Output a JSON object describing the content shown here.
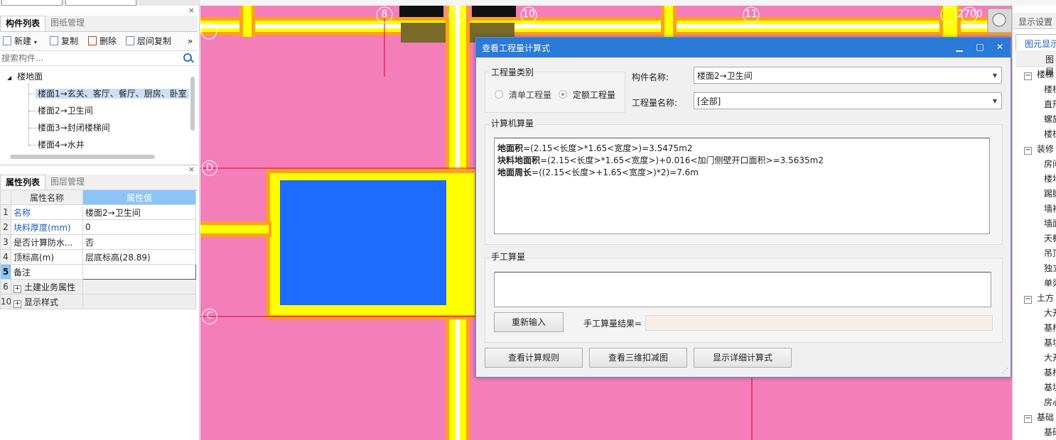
{
  "left_top": {
    "close": "×",
    "tabs": [
      "构件列表",
      "图纸管理"
    ],
    "toolbar": {
      "new": "新建",
      "copy": "复制",
      "delete": "删除",
      "floor_copy": "层间复制",
      "more": "»"
    },
    "search_placeholder": "搜索构件...",
    "tree": {
      "root": "楼地面",
      "items": [
        "楼面1→玄关、客厅、餐厅、厨房、卧室",
        "楼面2→卫生间",
        "楼面3→封闭楼梯间",
        "楼面4→水井"
      ]
    }
  },
  "left_bottom": {
    "close": "×",
    "tabs": [
      "属性列表",
      "图层管理"
    ],
    "header": {
      "name": "属性名称",
      "value": "属性值"
    },
    "rows": [
      {
        "num": "1",
        "name": "名称",
        "value": "楼面2→卫生间"
      },
      {
        "num": "2",
        "name": "块料厚度(mm)",
        "value": "0"
      },
      {
        "num": "3",
        "name": "是否计算防水...",
        "value": "否"
      },
      {
        "num": "4",
        "name": "顶标高(m)",
        "value": "层底标高(28.89)"
      },
      {
        "num": "5",
        "name": "备注",
        "value": ""
      },
      {
        "num": "6",
        "name": "土建业务属性",
        "value": ""
      },
      {
        "num": "10",
        "name": "显示样式",
        "value": ""
      }
    ]
  },
  "canvas": {
    "axis_labels": [
      "8",
      "9",
      "10",
      "11",
      "2700"
    ],
    "row_labels": [
      "D",
      "C"
    ]
  },
  "dialog": {
    "title": "查看工程量计算式",
    "window_buttons": {
      "min": "▁",
      "max": "□",
      "close": "✕"
    },
    "qty_type": {
      "label": "工程量类别",
      "options": [
        "清单工程量",
        "定额工程量"
      ],
      "selected": "定额工程量"
    },
    "component_name": {
      "label": "构件名称:",
      "value": "楼面2→卫生间"
    },
    "qty_name": {
      "label": "工程量名称:",
      "value": "[全部]"
    },
    "computer": {
      "label": "计算机算量",
      "lines": [
        {
          "key": "地面积",
          "expr": "=(2.15<长度>*1.65<宽度>)=3.5475m2"
        },
        {
          "key": "块料地面积",
          "expr": "=(2.15<长度>*1.65<宽度>)+0.016<加门侧壁开口面积>=3.5635m2"
        },
        {
          "key": "地面周长",
          "expr": "=((2.15<长度>+1.65<宽度>)*2)=7.6m"
        }
      ]
    },
    "manual": {
      "label": "手工算量",
      "reenter": "重新输入",
      "result_label": "手工算量结果="
    },
    "buttons": {
      "rules": "查看计算规则",
      "view3d": "查看三维扣减图",
      "detail": "显示详细计算式"
    }
  },
  "right_panel": {
    "title": "显示设置",
    "tab": "图元显示",
    "col_header": "图层",
    "groups": [
      {
        "label": "楼梯",
        "items": [
          "楼梯",
          "直形",
          "螺旋",
          "楼梯"
        ]
      },
      {
        "label": "装修",
        "items": [
          "房间",
          "楼地",
          "踢脚",
          "墙裙",
          "墙面",
          "天棚",
          "吊顶",
          "独立",
          "单梁"
        ]
      },
      {
        "label": "土方",
        "items": [
          "大开",
          "基槽",
          "基坑",
          "大开",
          "基槽",
          "基坑",
          "房心"
        ]
      },
      {
        "label": "基础",
        "items": [
          "基础"
        ]
      }
    ]
  },
  "colors": {
    "canvas_pink": "#f47eb9",
    "slab_blue": "#1f6bff",
    "title_blue": "#2a7ad8",
    "wall_yellow": "#ffff00",
    "wall_orange": "#ffa01e"
  }
}
